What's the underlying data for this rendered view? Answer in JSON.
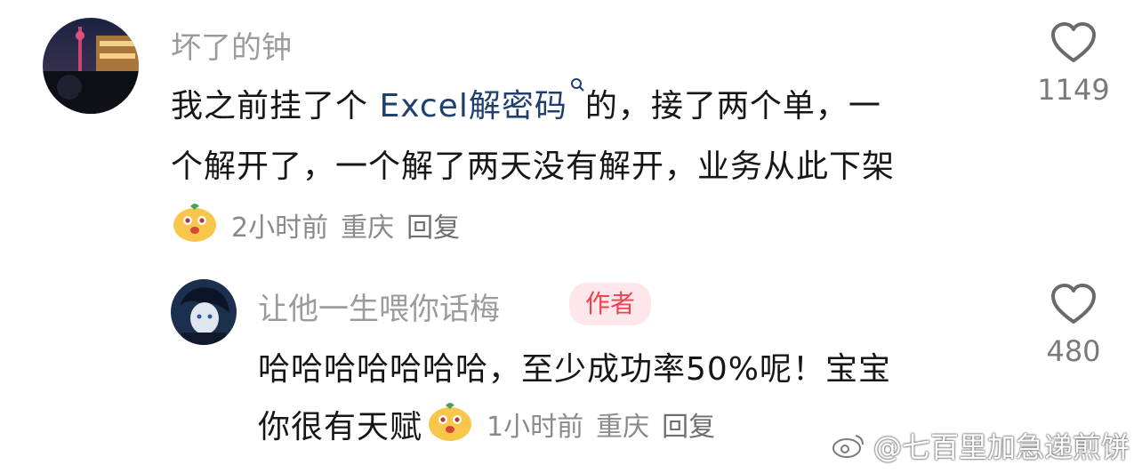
{
  "comment": {
    "username": "坏了的钟",
    "text_line1_prefix": "我之前挂了个 ",
    "text_line1_keyword": "Excel解密码",
    "text_line1_suffix": "的，接了两个单，一",
    "text_line2": "个解开了，一个解了两天没有解开，业务从此下架",
    "time": "2小时前",
    "location": "重庆",
    "reply_label": "回复",
    "likes": "1149"
  },
  "reply": {
    "username": "让他一生喂你话梅",
    "badge": "作者",
    "text_line1": "哈哈哈哈哈哈哈，至少成功率50%呢！宝宝",
    "text_line2": "你很有天赋",
    "time": "1小时前",
    "location": "重庆",
    "reply_label": "回复",
    "likes": "480"
  },
  "watermark": "@七百里加急递煎饼",
  "icons": {
    "like": "heart-outline-icon",
    "search_keyword": "search-icon",
    "emoji": "cute-face-emoji-icon"
  },
  "colors": {
    "username": "#9b9b9b",
    "keyword": "#1f3f6e",
    "badge_bg": "#fde7ea",
    "badge_text": "#f0424f"
  }
}
